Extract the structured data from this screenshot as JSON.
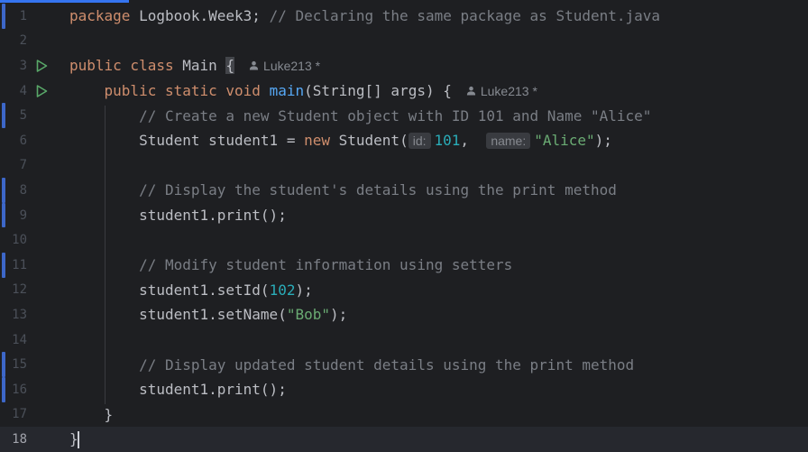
{
  "editor": {
    "current_line": 18,
    "lines": [
      {
        "num": "1",
        "parts": [
          {
            "text": "package",
            "cls": "kw"
          },
          {
            "text": " Logbook.Week3; ",
            "cls": ""
          },
          {
            "text": "// Declaring the same package as Student.java",
            "cls": "cm"
          }
        ],
        "changed": true
      },
      {
        "num": "2",
        "parts": []
      },
      {
        "num": "3",
        "run_icon": true,
        "parts": [
          {
            "text": "public class",
            "cls": "kw"
          },
          {
            "text": " Main ",
            "cls": ""
          },
          {
            "text": "{",
            "cls": "brace-hl"
          }
        ],
        "author": "Luke213 *"
      },
      {
        "num": "4",
        "run_icon": true,
        "parts": [
          {
            "text": "    public static void",
            "cls": "kw"
          },
          {
            "text": " ",
            "cls": ""
          },
          {
            "text": "main",
            "cls": "fn"
          },
          {
            "text": "(String[] args) {",
            "cls": ""
          }
        ],
        "author": "Luke213 *"
      },
      {
        "num": "5",
        "parts": [
          {
            "text": "        // Create a new Student object with ID 101 and Name \"Alice\"",
            "cls": "cm"
          }
        ],
        "changed": true
      },
      {
        "num": "6",
        "parts": [
          {
            "text": "        Student student1 = ",
            "cls": ""
          },
          {
            "text": "new",
            "cls": "kw"
          },
          {
            "text": " Student(",
            "cls": ""
          },
          {
            "hint": "id:"
          },
          {
            "text": "101",
            "cls": "num"
          },
          {
            "text": ",  ",
            "cls": ""
          },
          {
            "hint": "name:"
          },
          {
            "text": "\"Alice\"",
            "cls": "str"
          },
          {
            "text": ");",
            "cls": ""
          }
        ]
      },
      {
        "num": "7",
        "parts": []
      },
      {
        "num": "8",
        "parts": [
          {
            "text": "        // Display the student's details using the print method",
            "cls": "cm"
          }
        ],
        "changed": true
      },
      {
        "num": "9",
        "parts": [
          {
            "text": "        student1.print();",
            "cls": ""
          }
        ],
        "changed": true
      },
      {
        "num": "10",
        "parts": []
      },
      {
        "num": "11",
        "parts": [
          {
            "text": "        // Modify student information using setters",
            "cls": "cm"
          }
        ],
        "changed": true
      },
      {
        "num": "12",
        "parts": [
          {
            "text": "        student1.setId(",
            "cls": ""
          },
          {
            "text": "102",
            "cls": "num"
          },
          {
            "text": ");",
            "cls": ""
          }
        ]
      },
      {
        "num": "13",
        "parts": [
          {
            "text": "        student1.setName(",
            "cls": ""
          },
          {
            "text": "\"Bob\"",
            "cls": "str"
          },
          {
            "text": ");",
            "cls": ""
          }
        ]
      },
      {
        "num": "14",
        "parts": []
      },
      {
        "num": "15",
        "parts": [
          {
            "text": "        // Display updated student details using the print method",
            "cls": "cm"
          }
        ],
        "changed": true
      },
      {
        "num": "16",
        "parts": [
          {
            "text": "        student1.print();",
            "cls": ""
          }
        ],
        "changed": true
      },
      {
        "num": "17",
        "parts": [
          {
            "text": "    }",
            "cls": ""
          }
        ]
      },
      {
        "num": "18",
        "parts": [
          {
            "text": "}",
            "cls": ""
          }
        ],
        "caret": true
      }
    ]
  },
  "colors": {
    "background": "#1e1f22",
    "keyword": "#cf8e6d",
    "comment": "#7a7e85",
    "function": "#56a8f5",
    "number": "#2aacb8",
    "string": "#6aab73",
    "run_icon": "#59a869",
    "change_marker": "#3d67c9"
  }
}
